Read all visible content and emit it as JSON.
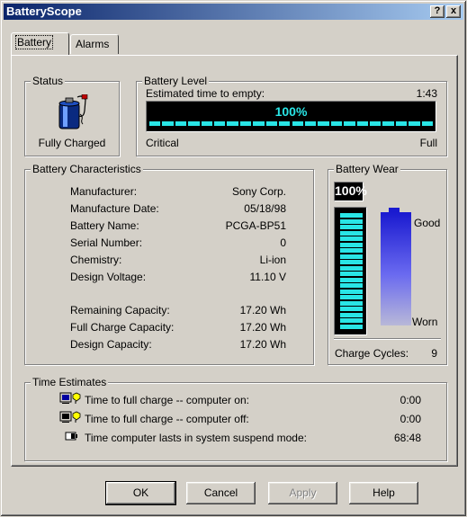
{
  "window": {
    "title": "BatteryScope",
    "help_button": "?",
    "close_button": "x"
  },
  "tabs": [
    {
      "label": "Battery",
      "active": true
    },
    {
      "label": "Alarms",
      "active": false
    }
  ],
  "status": {
    "legend": "Status",
    "icon": "battery-charging-icon",
    "text": "Fully Charged"
  },
  "battery_level": {
    "legend": "Battery Level",
    "time_label": "Estimated time to empty:",
    "time_value": "1:43",
    "percent_text": "100%",
    "level_fraction": 1.0,
    "min_label": "Critical",
    "max_label": "Full",
    "fill_color": "#29e5e6"
  },
  "characteristics": {
    "legend": "Battery Characteristics",
    "rows": [
      {
        "label": "Manufacturer:",
        "value": "Sony Corp."
      },
      {
        "label": "Manufacture Date:",
        "value": "05/18/98"
      },
      {
        "label": "Battery Name:",
        "value": "PCGA-BP51"
      },
      {
        "label": "Serial Number:",
        "value": "0"
      },
      {
        "label": "Chemistry:",
        "value": "Li-ion"
      },
      {
        "label": "Design Voltage:",
        "value": "11.10 V"
      }
    ],
    "capacity_rows": [
      {
        "label": "Remaining Capacity:",
        "value": "17.20 Wh"
      },
      {
        "label": "Full Charge Capacity:",
        "value": "17.20 Wh"
      },
      {
        "label": "Design Capacity:",
        "value": "17.20 Wh"
      }
    ]
  },
  "wear": {
    "legend": "Battery Wear",
    "percent_text": "100%",
    "level_fraction": 1.0,
    "good_label": "Good",
    "worn_label": "Worn",
    "cycles_label": "Charge Cycles:",
    "cycles_value": "9"
  },
  "time_estimates": {
    "legend": "Time Estimates",
    "rows": [
      {
        "icon": "computer-on-charge-icon",
        "label": "Time to full charge -- computer on:",
        "value": "0:00"
      },
      {
        "icon": "computer-off-charge-icon",
        "label": "Time to full charge -- computer off:",
        "value": "0:00"
      },
      {
        "icon": "suspend-battery-icon",
        "label": "Time computer lasts in system suspend mode:",
        "value": "68:48"
      }
    ]
  },
  "buttons": {
    "ok": "OK",
    "cancel": "Cancel",
    "apply": "Apply",
    "help": "Help"
  }
}
